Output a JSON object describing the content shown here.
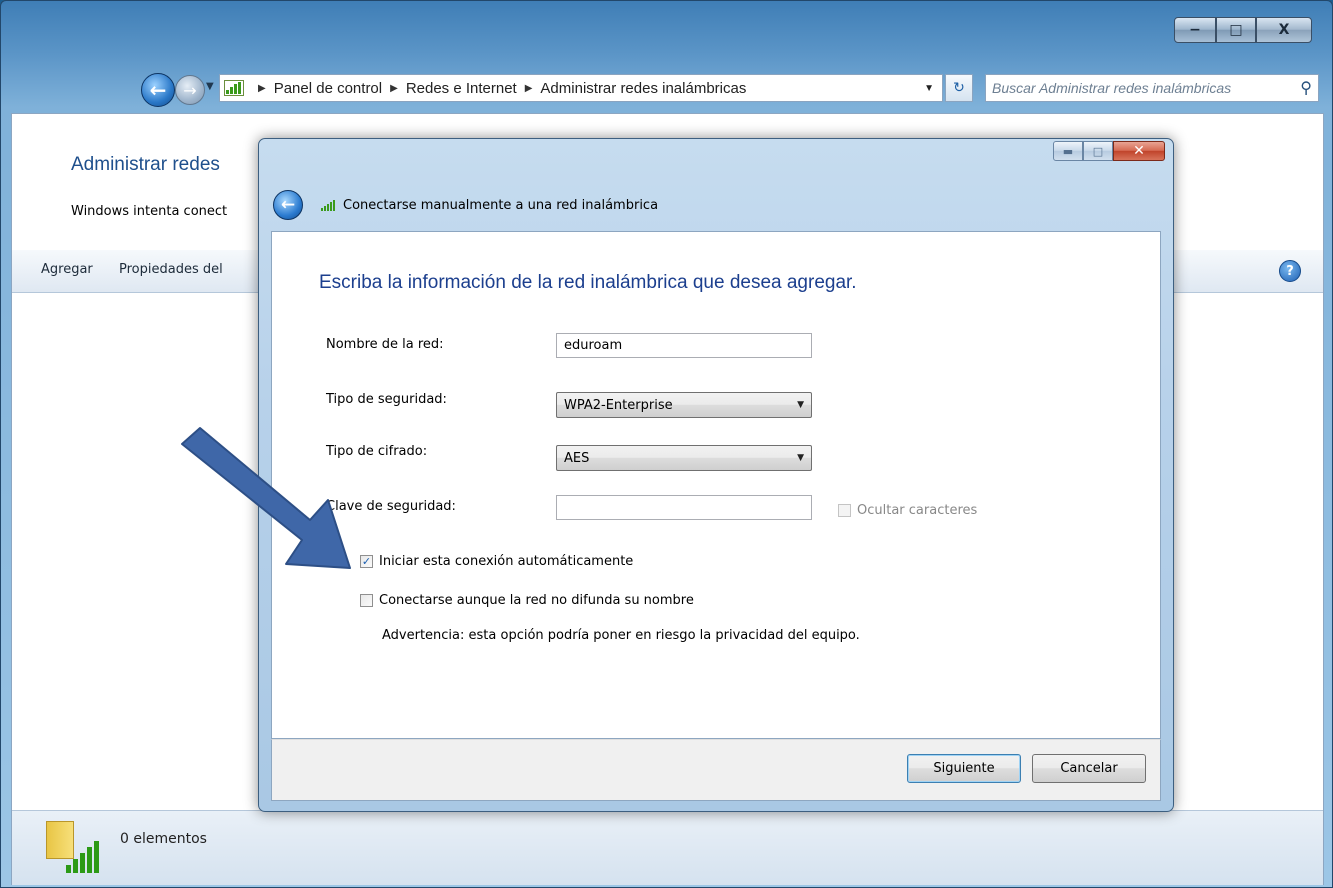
{
  "window": {
    "controls": {
      "minimize": "−",
      "maximize": "□",
      "close": "X"
    }
  },
  "address": {
    "crumbs": [
      "Panel de control",
      "Redes e Internet",
      "Administrar redes inalámbricas"
    ],
    "search_placeholder": "Buscar Administrar redes inalámbricas"
  },
  "page": {
    "title": "Administrar redes",
    "description": "Windows intenta conect",
    "toolbar": {
      "add": "Agregar",
      "properties": "Propiedades del"
    },
    "help": "?"
  },
  "status": {
    "items": "0 elementos"
  },
  "dialog": {
    "heading": "Conectarse manualmente a una red inalámbrica",
    "instruction": "Escriba la información de la red inalámbrica que desea agregar.",
    "fields": {
      "network_name_label": "Nombre de la red:",
      "network_name_value": "eduroam",
      "security_type_label": "Tipo de seguridad:",
      "security_type_value": "WPA2-Enterprise",
      "encryption_type_label": "Tipo de cifrado:",
      "encryption_type_value": "AES",
      "security_key_label": "Clave de seguridad:",
      "security_key_value": "",
      "hide_chars_label": "Ocultar caracteres"
    },
    "options": {
      "auto_connect_label": "Iniciar esta conexión automáticamente",
      "auto_connect_checked": true,
      "hidden_network_label": "Conectarse aunque la red no difunda su nombre",
      "hidden_network_checked": false,
      "warning": "Advertencia: esta opción podría poner en riesgo la privacidad del equipo."
    },
    "buttons": {
      "next": "Siguiente",
      "cancel": "Cancelar"
    }
  },
  "colors": {
    "accent_title": "#1e4f8c",
    "instruction_text": "#1c3f8e",
    "annotation_arrow": "#3f67a8"
  }
}
